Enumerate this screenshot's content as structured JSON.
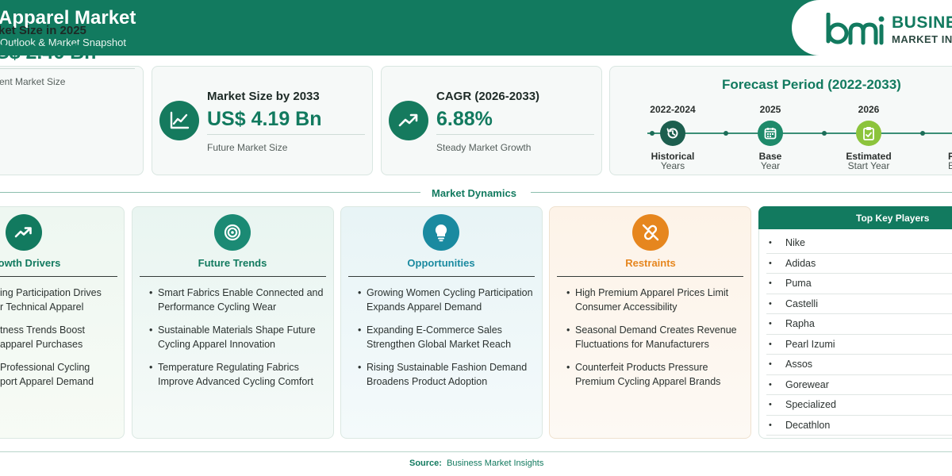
{
  "header": {
    "title": "Apparel Market",
    "subtitle": "Outlook & Market Snapshot",
    "logo_line1": "BUSINE",
    "logo_line2": "MARKET INSI"
  },
  "stats": [
    {
      "label": "ket Size in 2025",
      "value": "S$ 2.46 Bn",
      "note": "ent Market Size",
      "icon": "bar-chart-icon"
    },
    {
      "label": "Market Size by 2033",
      "value": "US$ 4.19 Bn",
      "note": "Future Market Size",
      "icon": "line-chart-icon"
    },
    {
      "label": "CAGR (2026-2033)",
      "value": "6.88%",
      "note": "Steady Market Growth",
      "icon": "trend-up-icon"
    }
  ],
  "forecast": {
    "title": "Forecast Period (2022-2033)",
    "stages": [
      {
        "year": "2022-2024",
        "line1": "Historical",
        "line2": "Years",
        "icon": "history-icon"
      },
      {
        "year": "2025",
        "line1": "Base",
        "line2": "Year",
        "icon": "calendar-icon"
      },
      {
        "year": "2026",
        "line1": "Estimated",
        "line2": "Start Year",
        "icon": "clipboard-check-icon"
      },
      {
        "year": "",
        "line1": "P",
        "line2": "E",
        "icon": ""
      }
    ]
  },
  "dynamics": {
    "title": "Market Dynamics",
    "cards": [
      {
        "title": "owth Drivers",
        "color": "#127a5f",
        "icon": "trend-up-icon",
        "items": [
          "ing Participation Drives\nr Technical Apparel",
          "tness Trends Boost\napparel Purchases",
          "Professional Cycling\nport Apparel Demand"
        ]
      },
      {
        "title": "Future Trends",
        "color": "#127a5f",
        "icon": "target-icon",
        "items": [
          "Smart Fabrics Enable Connected and Performance Cycling Wear",
          "Sustainable Materials Shape Future Cycling Apparel Innovation",
          "Temperature Regulating Fabrics Improve Advanced Cycling Comfort"
        ]
      },
      {
        "title": "Opportunities",
        "color": "#1a8aa0",
        "icon": "lightbulb-icon",
        "items": [
          "Growing Women Cycling Participation Expands Apparel Demand",
          "Expanding E-Commerce Sales Strengthen Global Market Reach",
          "Rising Sustainable Fashion Demand Broadens Product Adoption"
        ]
      },
      {
        "title": "Restraints",
        "color": "#e6861e",
        "icon": "broken-link-icon",
        "items": [
          "High Premium Apparel Prices Limit Consumer Accessibility",
          "Seasonal Demand Creates Revenue Fluctuations for Manufacturers",
          "Counterfeit Products Pressure Premium Cycling Apparel Brands"
        ]
      }
    ]
  },
  "key_players": {
    "title": "Top Key Players",
    "items": [
      "Nike",
      "Adidas",
      "Puma",
      "Castelli",
      "Rapha",
      "Pearl Izumi",
      "Assos",
      "Gorewear",
      "Specialized",
      "Decathlon"
    ]
  },
  "footer": {
    "label": "Source:",
    "value": "Business Market Insights"
  },
  "colors": {
    "brand": "#127a5f",
    "opportunity": "#1a8aa0",
    "restraint": "#e6861e"
  }
}
